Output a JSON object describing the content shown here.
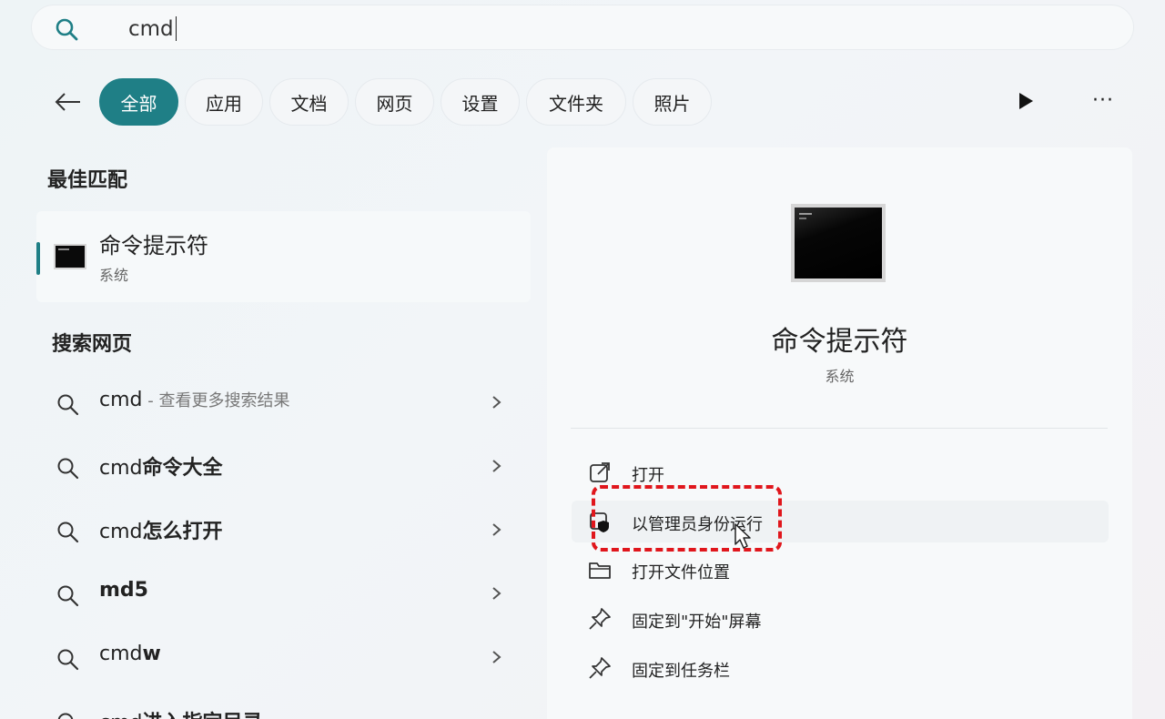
{
  "search": {
    "query": "cmd"
  },
  "filters": [
    {
      "label": "全部",
      "active": true
    },
    {
      "label": "应用",
      "active": false
    },
    {
      "label": "文档",
      "active": false
    },
    {
      "label": "网页",
      "active": false
    },
    {
      "label": "设置",
      "active": false
    },
    {
      "label": "文件夹",
      "active": false
    },
    {
      "label": "照片",
      "active": false
    }
  ],
  "more_label": "···",
  "best_match": {
    "section_title": "最佳匹配",
    "name": "命令提示符",
    "type": "系统"
  },
  "web_search": {
    "section_title": "搜索网页",
    "items": [
      {
        "prefix": "cmd",
        "bold": "",
        "suffix": " - 查看更多搜索结果"
      },
      {
        "prefix": "cmd",
        "bold": "命令大全",
        "suffix": ""
      },
      {
        "prefix": "cmd",
        "bold": "怎么打开",
        "suffix": ""
      },
      {
        "prefix": "",
        "bold": "md5",
        "suffix": ""
      },
      {
        "prefix": "cmd",
        "bold": "w",
        "suffix": ""
      },
      {
        "prefix": "cmd",
        "bold": "进入指定目录",
        "suffix": ""
      }
    ]
  },
  "detail": {
    "name": "命令提示符",
    "type": "系统",
    "actions": [
      {
        "label": "打开",
        "icon": "open-external-icon"
      },
      {
        "label": "以管理员身份运行",
        "icon": "shield-admin-icon"
      },
      {
        "label": "打开文件位置",
        "icon": "folder-icon"
      },
      {
        "label": "固定到\"开始\"屏幕",
        "icon": "pin-icon"
      },
      {
        "label": "固定到任务栏",
        "icon": "pin-icon"
      }
    ]
  },
  "colors": {
    "accent": "#1f7f86",
    "highlight_dash": "#e0161c"
  }
}
